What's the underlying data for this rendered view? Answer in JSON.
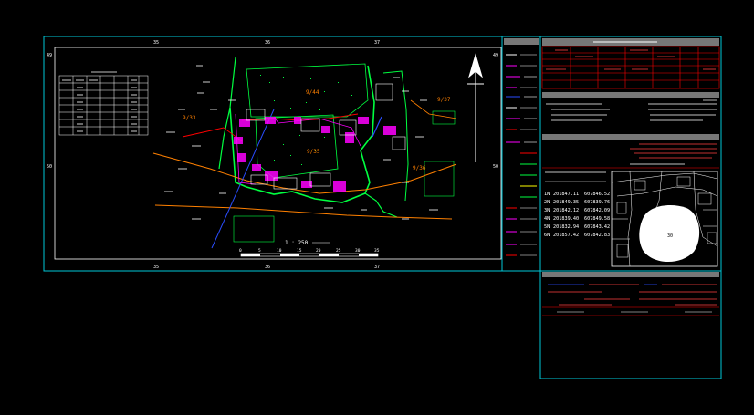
{
  "colors": {
    "background": "#000000",
    "frame": "#00c8d8",
    "boundary": "#00ff40",
    "parcel": "#ff00ff",
    "road": "#ff8000",
    "red": "#ff0000",
    "blue": "#2a4dff",
    "white": "#ffffff",
    "yellow": "#ffff00"
  },
  "drawing": {
    "scale_label": "1 : 250",
    "scale_ticks": [
      "0",
      "5",
      "10",
      "15",
      "20",
      "25",
      "30",
      "35"
    ],
    "parcel_labels": [
      "9/33",
      "9/35",
      "9/36",
      "9/37",
      "9/44"
    ],
    "grid_labels_top": [
      "35",
      "36",
      "37"
    ],
    "grid_labels_bottom": [
      "35",
      "36",
      "37"
    ],
    "grid_labels_side": [
      "49",
      "50"
    ]
  },
  "coordinates_table": {
    "rows": [
      {
        "id": "1N",
        "e": "201847.11",
        "n": "607846.52"
      },
      {
        "id": "2N",
        "e": "201849.35",
        "n": "607839.76"
      },
      {
        "id": "3N",
        "e": "201842.12",
        "n": "607842.09"
      },
      {
        "id": "4N",
        "e": "201839.40",
        "n": "607849.58"
      },
      {
        "id": "5N",
        "e": "201832.94",
        "n": "607843.42"
      },
      {
        "id": "6N",
        "e": "201857.42",
        "n": "607842.83"
      }
    ]
  },
  "key_map": {
    "parcel_label": "30"
  }
}
